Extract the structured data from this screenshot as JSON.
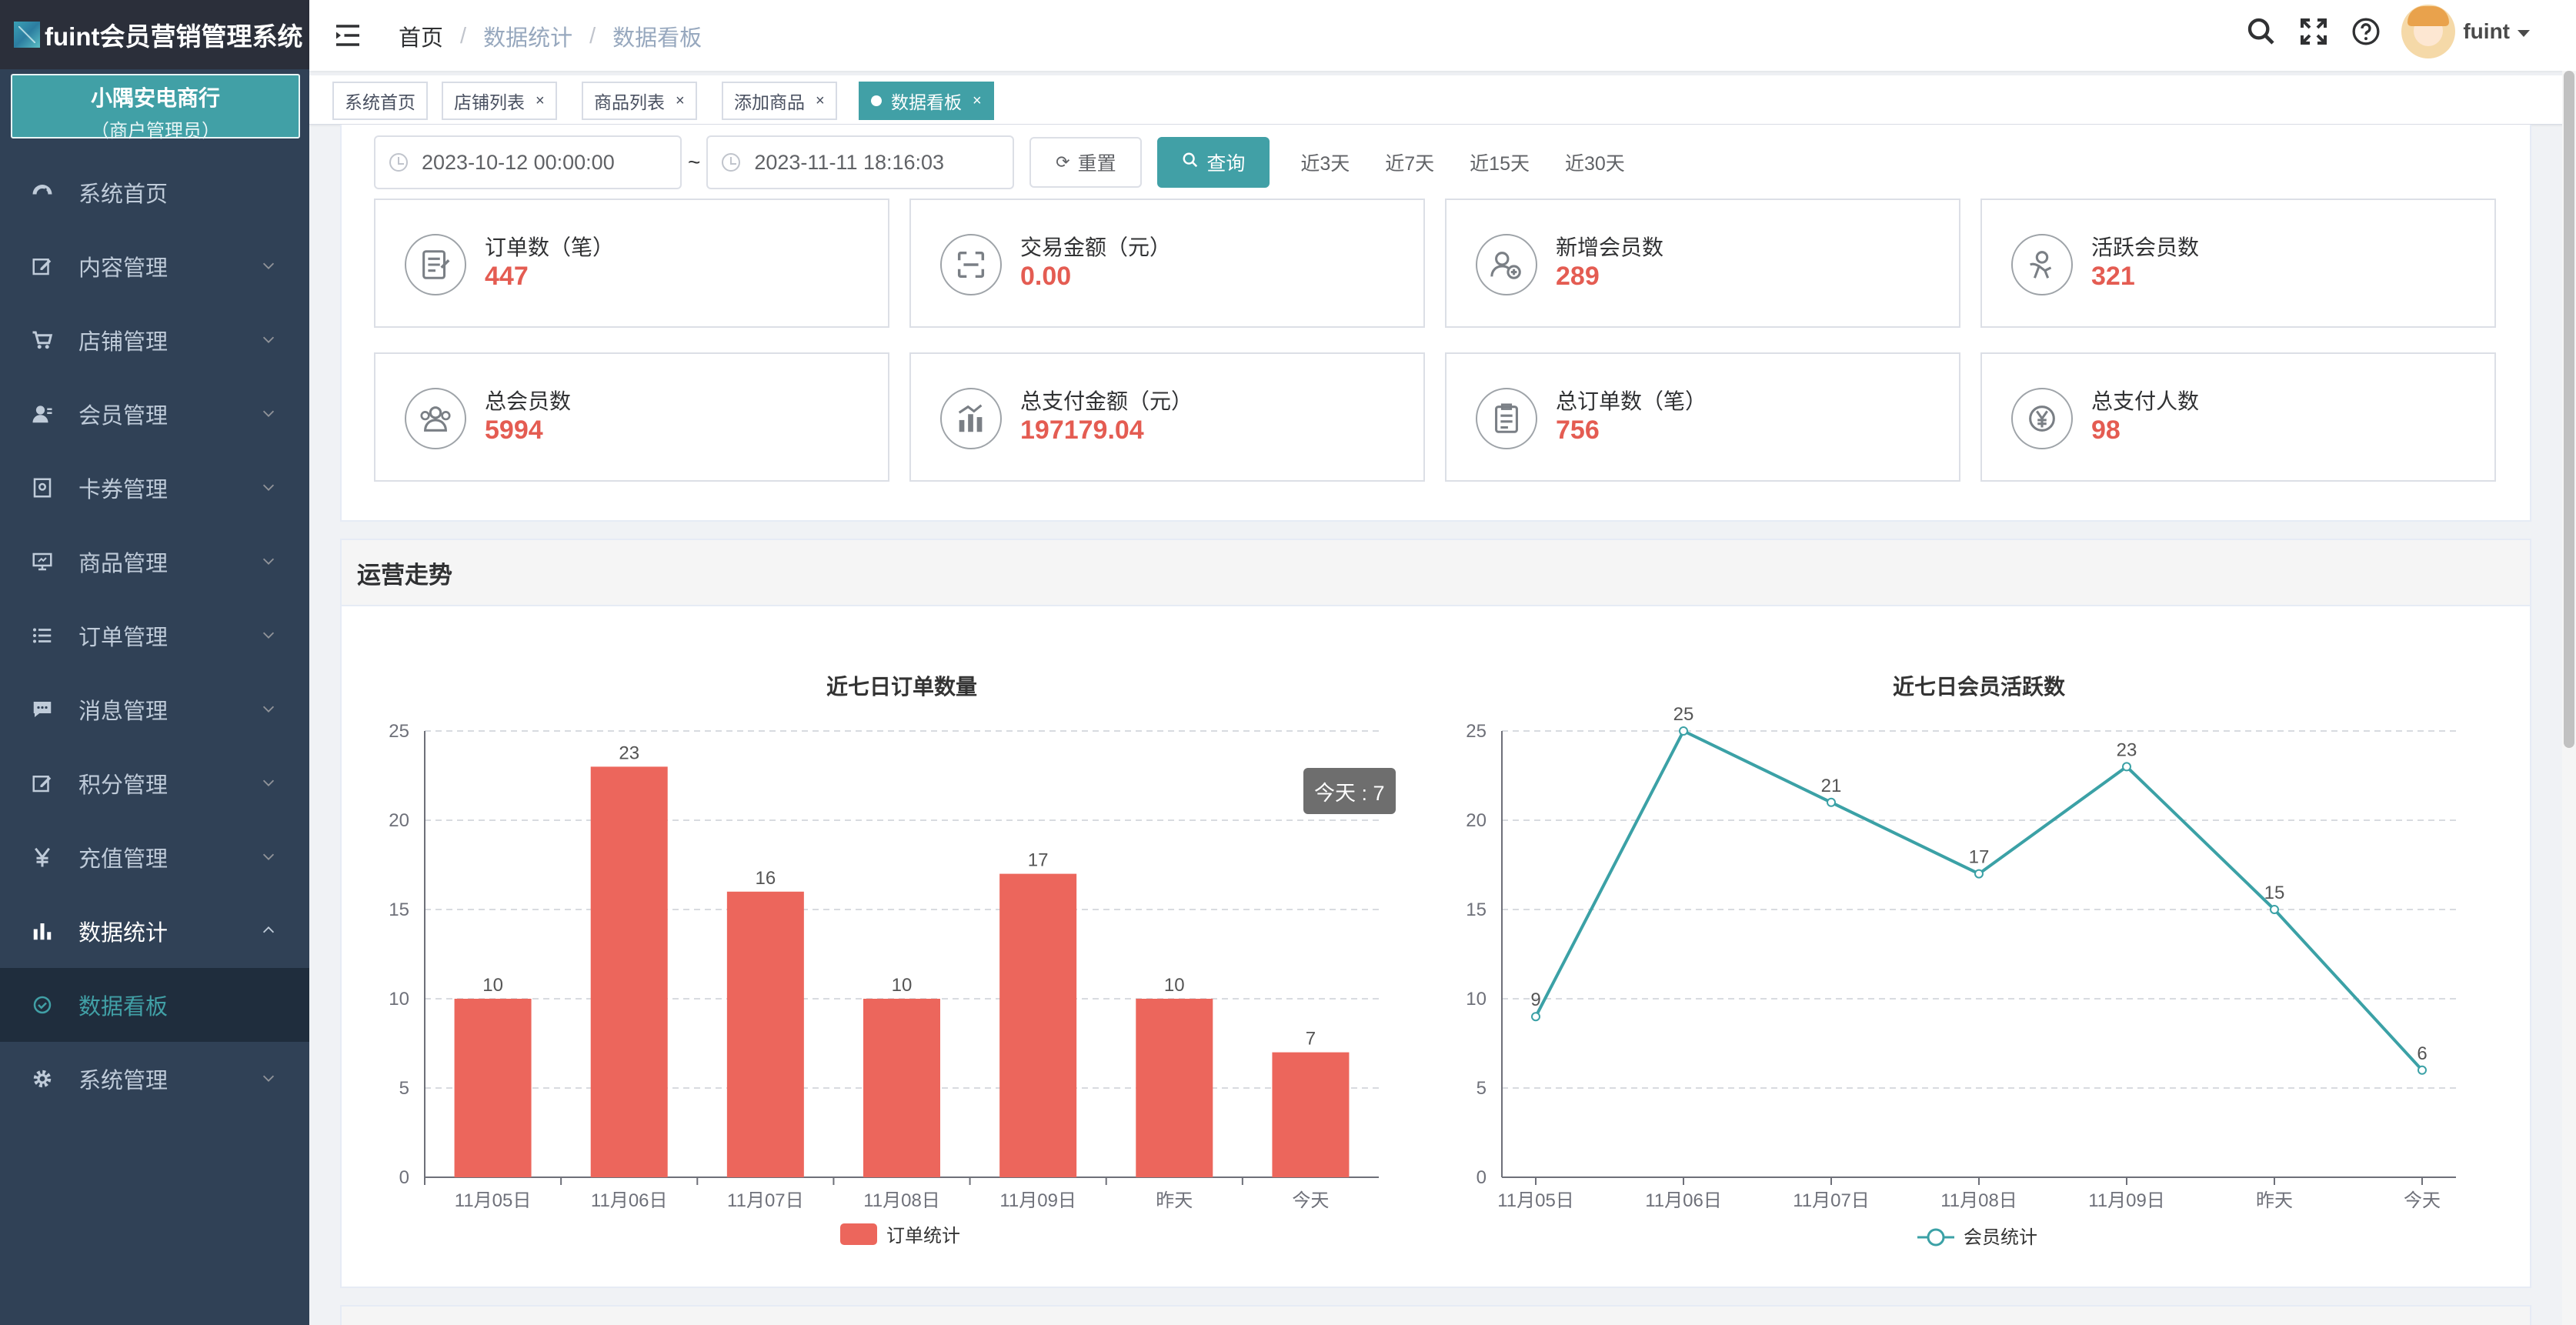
{
  "app": {
    "title": "fuint会员营销管理系统"
  },
  "merchant": {
    "name": "小隅安电商行",
    "role": "（商户管理员）"
  },
  "menu": [
    {
      "label": "系统首页",
      "icon": "dashboard-icon"
    },
    {
      "label": "内容管理",
      "icon": "edit-icon"
    },
    {
      "label": "店铺管理",
      "icon": "cart-icon"
    },
    {
      "label": "会员管理",
      "icon": "user-icon"
    },
    {
      "label": "卡券管理",
      "icon": "coupon-icon"
    },
    {
      "label": "商品管理",
      "icon": "monitor-icon"
    },
    {
      "label": "订单管理",
      "icon": "list-icon"
    },
    {
      "label": "消息管理",
      "icon": "message-icon"
    },
    {
      "label": "积分管理",
      "icon": "edit-icon"
    },
    {
      "label": "充值管理",
      "icon": "yen-icon"
    },
    {
      "label": "数据统计",
      "icon": "bar-chart-icon"
    },
    {
      "label": "数据看板",
      "icon": "circle-check-icon"
    },
    {
      "label": "系统管理",
      "icon": "gear-icon"
    }
  ],
  "breadcrumb": [
    "首页",
    "/",
    "数据统计",
    "/",
    "数据看板"
  ],
  "header": {
    "username": "fuint"
  },
  "tags": [
    {
      "label": "系统首页",
      "close": ""
    },
    {
      "label": "店铺列表",
      "close": "×"
    },
    {
      "label": "商品列表",
      "close": "×"
    },
    {
      "label": "添加商品",
      "close": "×"
    },
    {
      "label": "数据看板",
      "close": "×"
    }
  ],
  "filter": {
    "start": "2023-10-12 00:00:00",
    "separator": "~",
    "end": "2023-11-11 18:16:03",
    "reset": "重置",
    "query": "查询",
    "quick": [
      "近3天",
      "近7天",
      "近15天",
      "近30天"
    ]
  },
  "stats": [
    {
      "label": "订单数（笔）",
      "value": "447"
    },
    {
      "label": "交易金额（元）",
      "value": "0.00"
    },
    {
      "label": "新增会员数",
      "value": "289"
    },
    {
      "label": "活跃会员数",
      "value": "321"
    },
    {
      "label": "总会员数",
      "value": "5994"
    },
    {
      "label": "总支付金额（元）",
      "value": "197179.04"
    },
    {
      "label": "总订单数（笔）",
      "value": "756"
    },
    {
      "label": "总支付人数",
      "value": "98"
    }
  ],
  "trend": {
    "title": "运营走势"
  },
  "tooltip": {
    "text": "今天 : 7"
  },
  "colors": {
    "accent": "#41a0a6",
    "bar": "#ec665c",
    "line": "#3ba1a6",
    "value": "#e45c52",
    "sidebar": "#304156"
  },
  "chart_data": [
    {
      "type": "bar",
      "title": "近七日订单数量",
      "categories": [
        "11月05日",
        "11月06日",
        "11月07日",
        "11月08日",
        "11月09日",
        "昨天",
        "今天"
      ],
      "series": [
        {
          "name": "订单统计",
          "values": [
            10,
            23,
            16,
            10,
            17,
            10,
            7
          ]
        }
      ],
      "ylim": [
        0,
        25
      ],
      "yticks": [
        "0",
        "5",
        "10",
        "15",
        "20",
        "25"
      ],
      "grid": true,
      "legend": "bottom-center"
    },
    {
      "type": "line",
      "title": "近七日会员活跃数",
      "categories": [
        "11月05日",
        "11月06日",
        "11月07日",
        "11月08日",
        "11月09日",
        "昨天",
        "今天"
      ],
      "series": [
        {
          "name": "会员统计",
          "values": [
            9,
            25,
            21,
            17,
            23,
            15,
            6
          ]
        }
      ],
      "ylim": [
        0,
        25
      ],
      "yticks": [
        "0",
        "5",
        "10",
        "15",
        "20",
        "25"
      ],
      "grid": true,
      "legend": "bottom-center"
    }
  ]
}
